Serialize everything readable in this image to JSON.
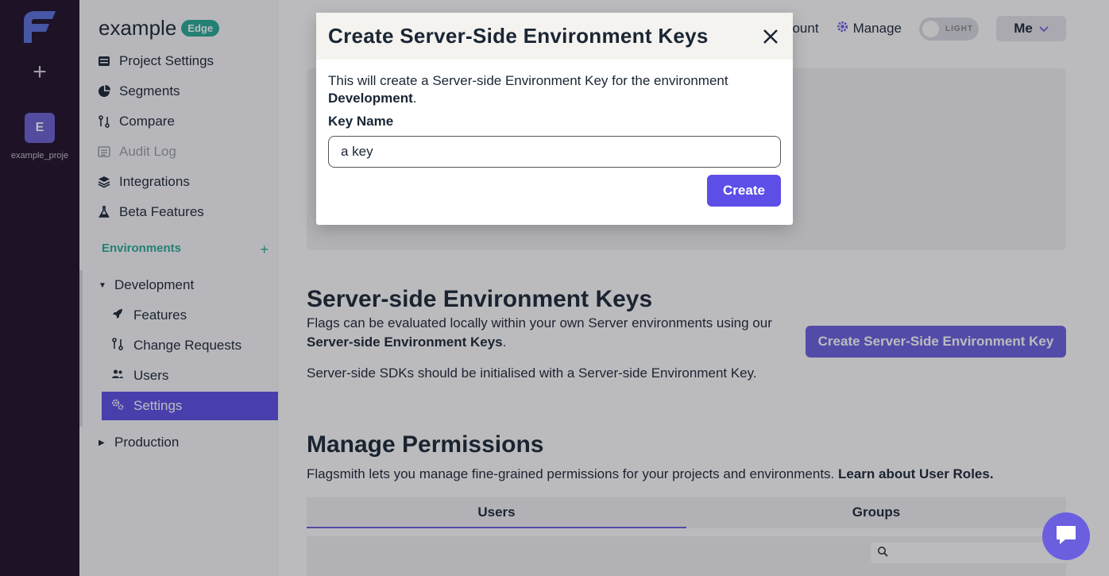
{
  "rail": {
    "project_initial": "E",
    "project_name": "example_proje"
  },
  "sidebar": {
    "project_title": "example",
    "project_badge": "Edge",
    "items": [
      {
        "label": "Project Settings"
      },
      {
        "label": "Segments"
      },
      {
        "label": "Compare"
      },
      {
        "label": "Audit Log"
      },
      {
        "label": "Integrations"
      },
      {
        "label": "Beta Features"
      }
    ],
    "environments_heading": "Environments",
    "env_development": "Development",
    "env_sub_items": [
      {
        "label": "Features"
      },
      {
        "label": "Change Requests"
      },
      {
        "label": "Users"
      },
      {
        "label": "Settings"
      }
    ],
    "env_production": "Production"
  },
  "topbar": {
    "account_label": "ccount",
    "manage_label": "Manage",
    "theme_toggle_label": "LIGHT",
    "user_menu_label": "Me"
  },
  "server_keys": {
    "heading": "Server-side Environment Keys",
    "desc_line1": "Flags can be evaluated locally within your own Server environments using our",
    "desc_strong": "Server-side Environment Keys",
    "desc_end": ".",
    "desc_line2": "Server-side SDKs should be initialised with a Server-side Environment Key.",
    "create_button": "Create Server-Side Environment Key"
  },
  "permissions": {
    "heading": "Manage Permissions",
    "desc": "Flagsmith lets you manage fine-grained permissions for your projects and environments.",
    "desc_link": "Learn about User Roles.",
    "tabs": [
      {
        "label": "Users"
      },
      {
        "label": "Groups"
      }
    ]
  },
  "modal": {
    "title": "Create Server-Side Environment Keys",
    "desc_prefix": "This will create a Server-side Environment Key for the environment",
    "desc_env": "Development",
    "desc_suffix": ".",
    "field_label": "Key Name",
    "field_value": "a key",
    "create_button": "Create"
  }
}
